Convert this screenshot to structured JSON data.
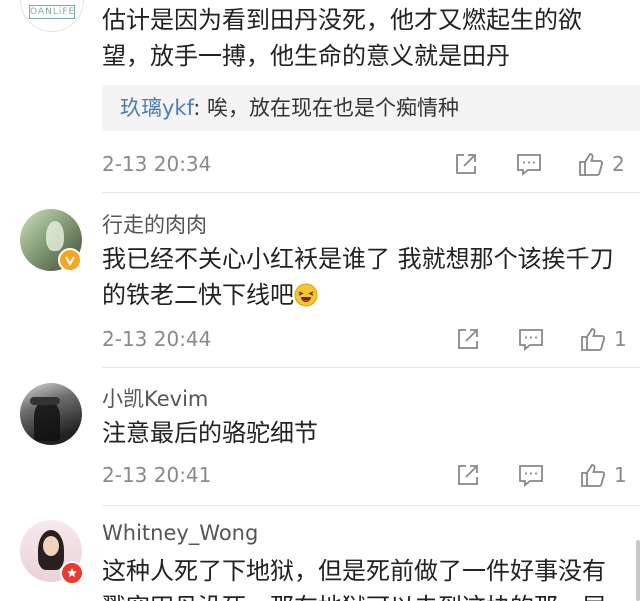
{
  "comments": [
    {
      "avatar_text": "OANLiFE",
      "content": "估计是因为看到田丹没死，他才又燃起生的欲望，放手一搏，他生命的意义就是田丹",
      "reply": {
        "author": "玖璃ykf",
        "text": ": 唉，放在现在也是个痴情种"
      },
      "time": "2-13 20:34",
      "likes": "2"
    },
    {
      "username": "行走的肉肉",
      "content": "我已经不关心小红袄是谁了 我就想那个该挨千刀的铁老二快下线吧",
      "time": "2-13 20:44",
      "likes": "1"
    },
    {
      "username": "小凯Kevim",
      "content": "注意最后的骆驼细节",
      "time": "2-13 20:41",
      "likes": "1"
    },
    {
      "username": "Whitney_Wong",
      "content": "这种人死了下地狱，但是死前做了一件好事没有戳穿田丹没死，那在地狱可以去到这块的那一层"
    }
  ],
  "colors": {
    "reply_author": "#507daf",
    "meta_gray": "#8a8a8a",
    "verified_badge": "#f5a623",
    "red_badge": "#e63b2e"
  },
  "icons": [
    "share-icon",
    "comment-icon",
    "like-icon",
    "verified-badge-icon",
    "laughing-emoji-icon"
  ]
}
